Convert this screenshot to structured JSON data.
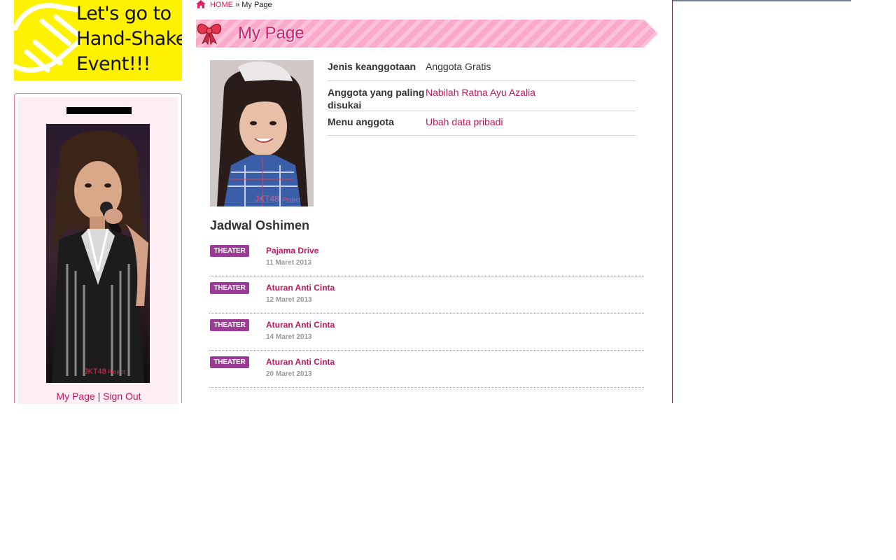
{
  "banner": {
    "lines": [
      "Let's go to",
      "Hand-Shake",
      "Event!!!"
    ]
  },
  "sidebar": {
    "links": {
      "my_page": "My Page",
      "separator": "|",
      "sign_out": "Sign Out"
    }
  },
  "breadcrumb": {
    "home": "HOME",
    "separator": "»",
    "current": "My Page"
  },
  "page_title": "My Page",
  "profile": {
    "rows": [
      {
        "label": "Jenis keanggotaan",
        "value": "Anggota Gratis"
      },
      {
        "label": "Anggota yang paling disukai",
        "value": "Nabilah Ratna Ayu Azalia"
      },
      {
        "label": "Menu anggota",
        "value": "Ubah data pribadi"
      }
    ],
    "photo_watermark": "JKT48 Project"
  },
  "schedule": {
    "title": "Jadwal Oshimen",
    "events": [
      {
        "badge": "THEATER",
        "title": "Pajama Drive",
        "date": "11 Maret 2013"
      },
      {
        "badge": "THEATER",
        "title": "Aturan Anti Cinta",
        "date": "12 Maret 2013"
      },
      {
        "badge": "THEATER",
        "title": "Aturan Anti Cinta",
        "date": "14 Maret 2013"
      },
      {
        "badge": "THEATER",
        "title": "Aturan Anti Cinta",
        "date": "20 Maret 2013"
      }
    ]
  },
  "colors": {
    "accent": "#c2185b",
    "badge": "#9c3a97",
    "banner_bg": "#fff200",
    "title_bar": "#f8a8c8"
  }
}
